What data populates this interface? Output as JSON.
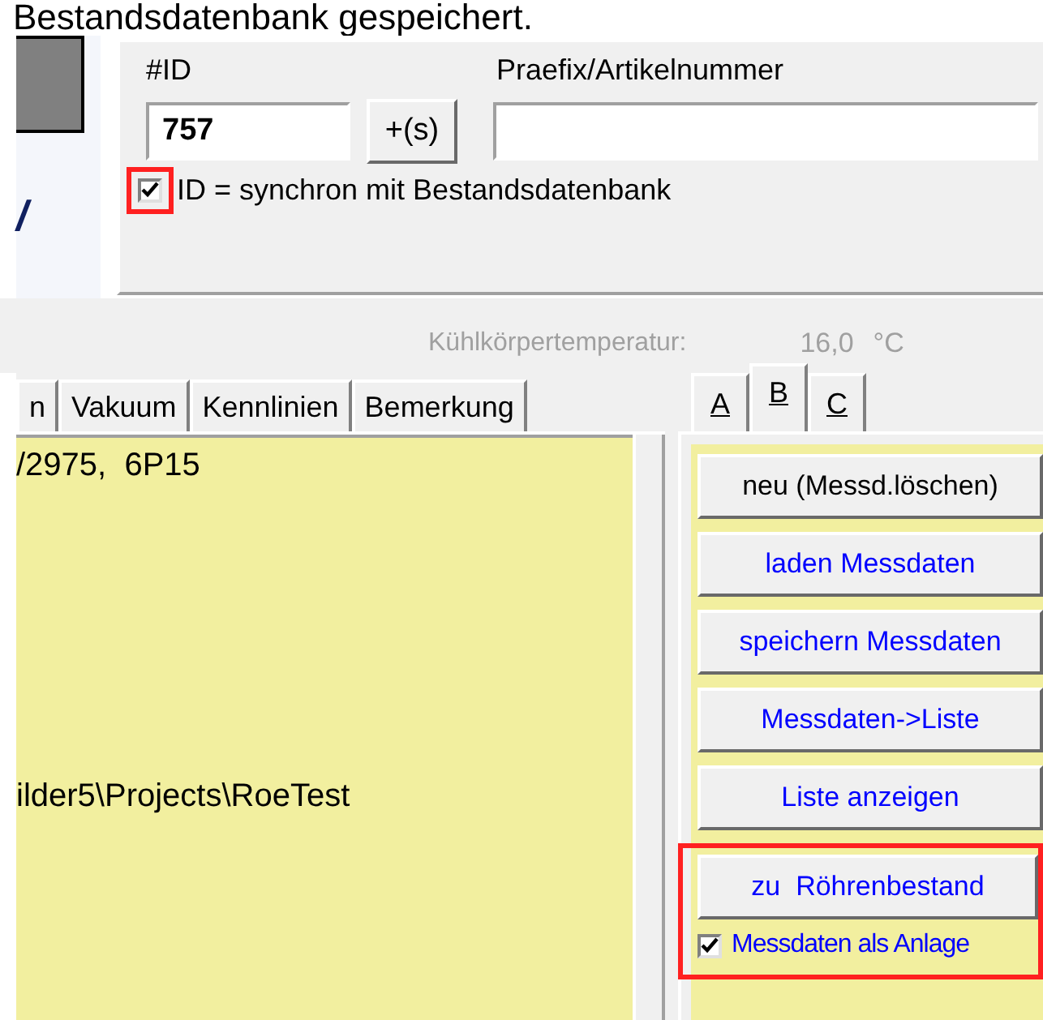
{
  "message": "Bestandsdatenbank gespeichert.",
  "left_panel": {
    "label": "/"
  },
  "id_group": {
    "id_label": "#ID",
    "id_value": "757",
    "plus_button": "+(s)",
    "prefix_label": "Praefix/Artikelnummer",
    "sync_checkbox": {
      "label": "ID = synchron mit Bestandsdatenbank",
      "checked": true,
      "highlighted": true
    }
  },
  "temperature": {
    "label": "Kühlkörpertemperatur:",
    "value": "16,0",
    "unit": "°C"
  },
  "tabs": [
    {
      "label": "n",
      "selected": false
    },
    {
      "label": "Vakuum",
      "selected": false
    },
    {
      "label": "Kennlinien",
      "selected": false
    },
    {
      "label": "Bemerkung",
      "selected": false
    }
  ],
  "memo_lines": [
    "/2975,  6P15",
    "ilder5\\Projects\\RoeTest"
  ],
  "side_tabs": [
    {
      "label": "A",
      "selected": false
    },
    {
      "label": "B",
      "selected": true
    },
    {
      "label": "C",
      "selected": false
    }
  ],
  "side_buttons": [
    {
      "label": "neu (Messd.löschen)",
      "color": "#000000",
      "highlighted": false
    },
    {
      "label": "laden Messdaten",
      "color": "#0000ff",
      "highlighted": false
    },
    {
      "label": "speichern Messdaten",
      "color": "#0000ff",
      "highlighted": false
    },
    {
      "label": "Messdaten->Liste",
      "color": "#0000ff",
      "highlighted": false
    },
    {
      "label": "Liste anzeigen",
      "color": "#0000ff",
      "highlighted": false
    },
    {
      "label": "zu  Röhrenbestand",
      "color": "#0000ff",
      "highlighted": true
    }
  ],
  "anlage_checkbox": {
    "label": "Messdaten als Anlage",
    "checked": true
  }
}
